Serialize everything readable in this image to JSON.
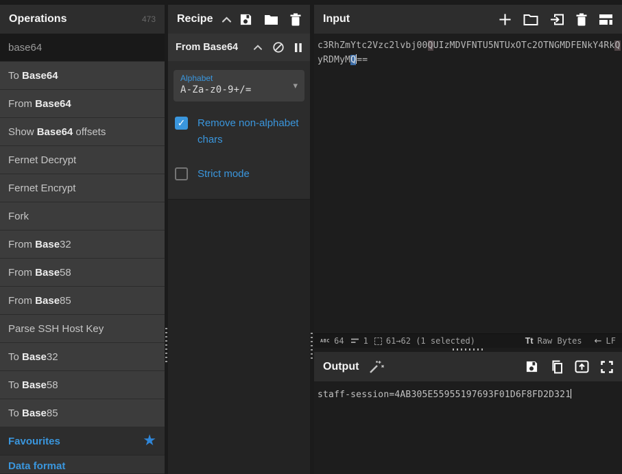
{
  "colors": {
    "accent": "#3a96dd",
    "selection_bg": "#3a6ba5",
    "match_bg": "#514548",
    "panel_header_bg": "#2d2d2d"
  },
  "operations_panel": {
    "title": "Operations",
    "count": "473",
    "search": {
      "value": "base64"
    },
    "items": [
      {
        "pre": "To ",
        "bold": "Base64",
        "post": ""
      },
      {
        "pre": "From ",
        "bold": "Base64",
        "post": ""
      },
      {
        "pre": "Show ",
        "bold": "Base64",
        "post": " offsets"
      },
      {
        "pre": "Fernet Decrypt",
        "bold": "",
        "post": ""
      },
      {
        "pre": "Fernet Encrypt",
        "bold": "",
        "post": ""
      },
      {
        "pre": "Fork",
        "bold": "",
        "post": ""
      },
      {
        "pre": "From ",
        "bold": "Base",
        "post": "32"
      },
      {
        "pre": "From ",
        "bold": "Base",
        "post": "58"
      },
      {
        "pre": "From ",
        "bold": "Base",
        "post": "85"
      },
      {
        "pre": "Parse SSH Host Key",
        "bold": "",
        "post": ""
      },
      {
        "pre": "To ",
        "bold": "Base",
        "post": "32"
      },
      {
        "pre": "To ",
        "bold": "Base",
        "post": "58"
      },
      {
        "pre": "To ",
        "bold": "Base",
        "post": "85"
      }
    ],
    "favourites": {
      "label": "Favourites"
    },
    "category": {
      "label": "Data format"
    }
  },
  "recipe_panel": {
    "title": "Recipe",
    "operation": {
      "name": "From Base64",
      "alphabet_label": "Alphabet",
      "alphabet_value": "A-Za-z0-9+/=",
      "remove_non_alphabet": {
        "label": "Remove non-alphabet chars",
        "checked": true
      },
      "strict_mode": {
        "label": "Strict mode",
        "checked": false
      }
    }
  },
  "input_panel": {
    "title": "Input",
    "line1": {
      "seg0": "c3RhZmYtc2Vzc2lvbj00",
      "seg1": "Q",
      "seg2": "UIzMDVFNTU5NTUxOTc2OTNGMDFENkY4Rk",
      "seg3": "Q"
    },
    "line2": {
      "seg0": "yRDMyM",
      "seg1": "Q",
      "seg2": "=="
    },
    "status_bar": {
      "char_count": "64",
      "line_count": "1",
      "selection": "61→62 (1 selected)",
      "encoding": "Raw Bytes",
      "eol": "LF"
    }
  },
  "output_panel": {
    "title": "Output",
    "text": "staff-session=4AB305E55955197693F01D6F8FD2D321"
  },
  "icons": {
    "star": "★",
    "checkmark": "✓",
    "caret_down": "▾",
    "abc_label": "ABC",
    "tt_label": "Tt",
    "eol_arrow": "←"
  }
}
